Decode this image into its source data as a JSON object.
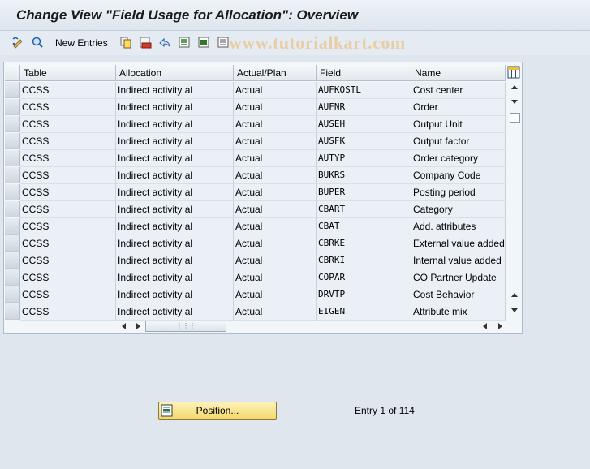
{
  "title": "Change View \"Field Usage for Allocation\": Overview",
  "toolbar": {
    "new_entries_label": "New Entries",
    "watermark": "www.tutorialkart.com"
  },
  "table": {
    "columns": [
      "Table",
      "Allocation",
      "Actual/Plan",
      "Field",
      "Name"
    ],
    "rows": [
      [
        "CCSS",
        "Indirect activity al",
        "Actual",
        "AUFKOSTL",
        "Cost center"
      ],
      [
        "CCSS",
        "Indirect activity al",
        "Actual",
        "AUFNR",
        "Order"
      ],
      [
        "CCSS",
        "Indirect activity al",
        "Actual",
        "AUSEH",
        "Output Unit"
      ],
      [
        "CCSS",
        "Indirect activity al",
        "Actual",
        "AUSFK",
        "Output factor"
      ],
      [
        "CCSS",
        "Indirect activity al",
        "Actual",
        "AUTYP",
        "Order category"
      ],
      [
        "CCSS",
        "Indirect activity al",
        "Actual",
        "BUKRS",
        "Company Code"
      ],
      [
        "CCSS",
        "Indirect activity al",
        "Actual",
        "BUPER",
        "Posting period"
      ],
      [
        "CCSS",
        "Indirect activity al",
        "Actual",
        "CBART",
        "Category"
      ],
      [
        "CCSS",
        "Indirect activity al",
        "Actual",
        "CBAT",
        "Add. attributes"
      ],
      [
        "CCSS",
        "Indirect activity al",
        "Actual",
        "CBRKE",
        "External value added"
      ],
      [
        "CCSS",
        "Indirect activity al",
        "Actual",
        "CBRKI",
        "Internal value added"
      ],
      [
        "CCSS",
        "Indirect activity al",
        "Actual",
        "COPAR",
        "CO Partner Update"
      ],
      [
        "CCSS",
        "Indirect activity al",
        "Actual",
        "DRVTP",
        "Cost Behavior"
      ],
      [
        "CCSS",
        "Indirect activity al",
        "Actual",
        "EIGEN",
        "Attribute mix"
      ]
    ]
  },
  "footer": {
    "position_label": "Position...",
    "entry_info": "Entry 1 of 114"
  }
}
